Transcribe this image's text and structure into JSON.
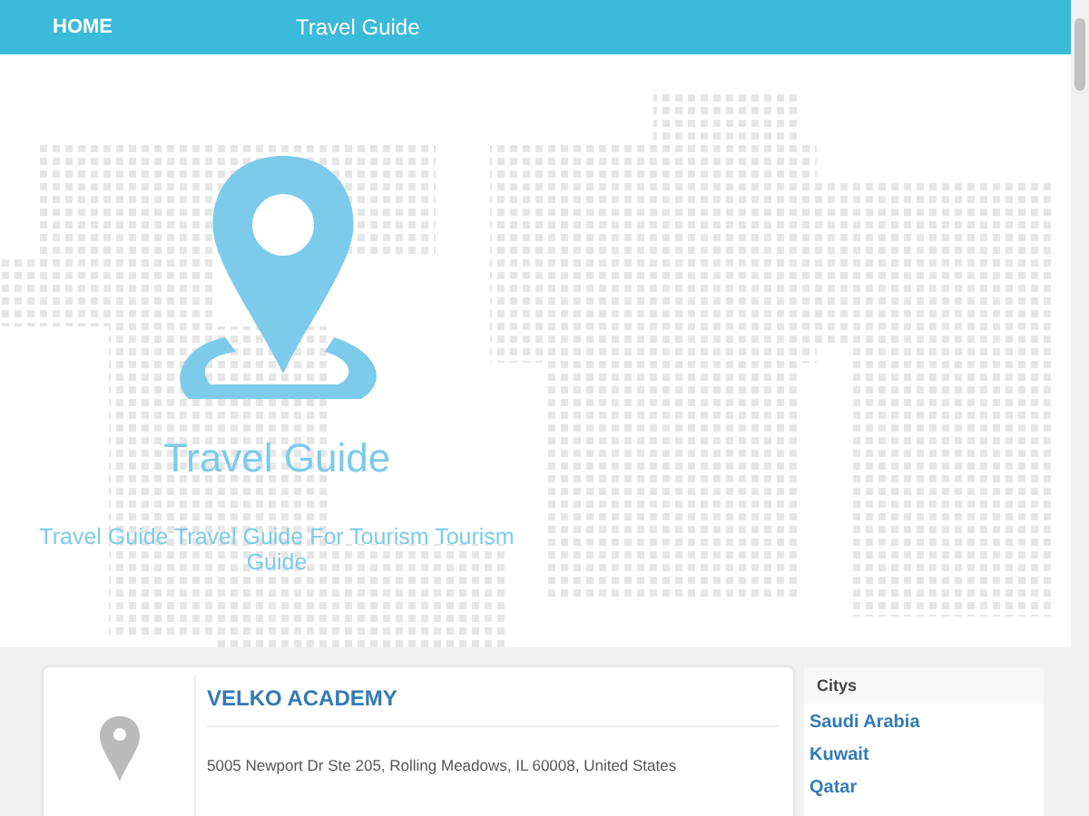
{
  "navbar": {
    "home_link": "HOME",
    "title": "Travel Guide"
  },
  "hero": {
    "title": "Travel Guide",
    "tagline": "Travel Guide Travel Guide For Tourism Tourism Guide"
  },
  "listings": [
    {
      "name": "VELKO ACADEMY",
      "address": "5005 Newport Dr Ste 205, Rolling Meadows, IL 60008, United States"
    }
  ],
  "sidebar": {
    "heading": "Citys",
    "items": [
      "Saudi Arabia",
      "Kuwait",
      "Qatar"
    ]
  }
}
